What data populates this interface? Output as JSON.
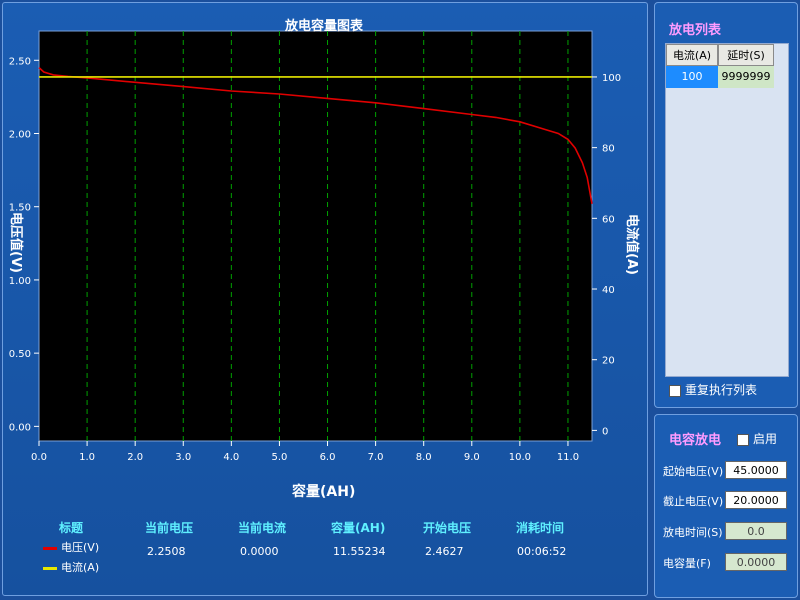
{
  "chart_data": {
    "type": "line",
    "title": "放电容量图表",
    "xlabel": "容量(AH)",
    "ylabel_left": "电压值(V)",
    "ylabel_right": "电流值(A)",
    "xlim": [
      0,
      11.5
    ],
    "ylim_left": [
      -0.1,
      2.7
    ],
    "ylim_right": [
      -3,
      113
    ],
    "x_ticks": [
      "0.0",
      "1.0",
      "2.0",
      "3.0",
      "4.0",
      "5.0",
      "6.0",
      "7.0",
      "8.0",
      "9.0",
      "10.0",
      "11.0"
    ],
    "y_left_ticks": [
      "0.00",
      "0.50",
      "1.00",
      "1.50",
      "2.00",
      "2.50"
    ],
    "y_right_ticks": [
      "0",
      "20",
      "40",
      "60",
      "80",
      "100"
    ],
    "grid": "vertical",
    "series": [
      {
        "name": "电压(V)",
        "color": "#e00000",
        "axis": "left",
        "x": [
          0,
          0.1,
          0.3,
          0.6,
          1.0,
          2.0,
          3.0,
          4.0,
          5.0,
          6.0,
          7.0,
          8.0,
          9.0,
          9.5,
          10.0,
          10.5,
          10.8,
          11.0,
          11.15,
          11.3,
          11.4,
          11.5
        ],
        "values": [
          2.45,
          2.42,
          2.4,
          2.39,
          2.38,
          2.35,
          2.32,
          2.29,
          2.27,
          2.24,
          2.21,
          2.17,
          2.13,
          2.11,
          2.08,
          2.03,
          2.0,
          1.96,
          1.9,
          1.8,
          1.7,
          1.52
        ]
      },
      {
        "name": "电流(A)",
        "color": "#e8e800",
        "axis": "right",
        "x": [
          0,
          11.5
        ],
        "values": [
          100,
          100
        ]
      }
    ]
  },
  "status": {
    "headers": [
      "标题",
      "当前电压",
      "当前电流",
      "容量(AH)",
      "开始电压",
      "消耗时间"
    ],
    "values": [
      "2.2508",
      "0.0000",
      "11.55234",
      "2.4627",
      "00:06:52"
    ],
    "legend": [
      {
        "label": "电压(V)",
        "color": "#e00000"
      },
      {
        "label": "电流(A)",
        "color": "#e8e800"
      }
    ]
  },
  "discharge_list": {
    "title": "放电列表",
    "columns": [
      "电流(A)",
      "延时(S)"
    ],
    "rows": [
      [
        "100",
        "9999999"
      ]
    ],
    "repeat_label": "重复执行列表"
  },
  "capacitor": {
    "title": "电容放电",
    "enable_label": "启用",
    "fields": [
      {
        "label": "起始电压(V)",
        "value": "45.0000"
      },
      {
        "label": "截止电压(V)",
        "value": "20.0000"
      },
      {
        "label": "放电时间(S)",
        "value": "0.0"
      },
      {
        "label": "电容量(F)",
        "value": "0.0000"
      }
    ]
  }
}
